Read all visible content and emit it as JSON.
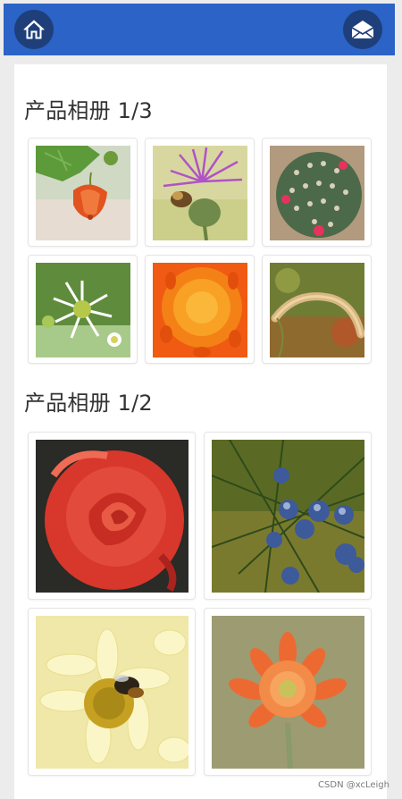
{
  "header": {
    "home_icon": "home-icon",
    "mail_icon": "envelope-icon",
    "bar_color": "#2b63c6"
  },
  "section1": {
    "title": "产品相册 1/3",
    "items": [
      {
        "label": "flower-orange-lantern"
      },
      {
        "label": "flower-purple-thistle-bee"
      },
      {
        "label": "cactus-pink-flowers"
      },
      {
        "label": "white-daisies"
      },
      {
        "label": "orange-dahlia"
      },
      {
        "label": "foxtail-grass"
      }
    ]
  },
  "section2": {
    "title": "产品相册 1/2",
    "items": [
      {
        "label": "red-rose"
      },
      {
        "label": "juniper-berries"
      },
      {
        "label": "yellow-chrysanthemum-bee"
      },
      {
        "label": "orange-chrysanthemum"
      }
    ]
  },
  "watermark": "CSDN @xcLeigh"
}
